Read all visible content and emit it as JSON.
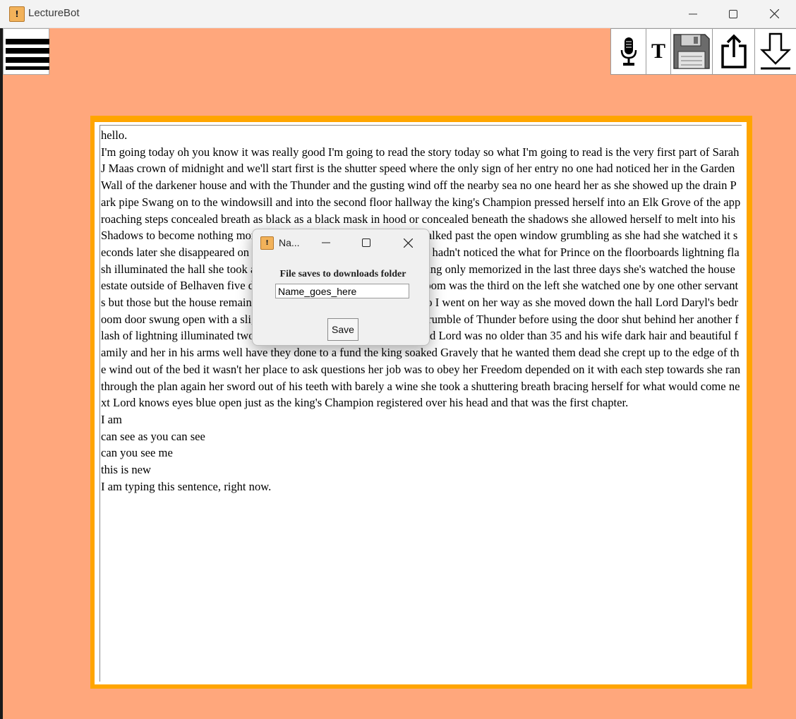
{
  "window": {
    "title": "LectureBot",
    "icon_glyph": "!"
  },
  "toolbar": {
    "menu_icon": "hamburger-menu-icon",
    "buttons": [
      {
        "name": "microphone-icon"
      },
      {
        "name": "text-icon",
        "glyph": "T"
      },
      {
        "name": "floppy-disk-save-icon"
      },
      {
        "name": "share-upload-icon"
      },
      {
        "name": "download-arrow-icon"
      }
    ]
  },
  "colors": {
    "background": "#ffa77c",
    "frame": "#ffa500"
  },
  "transcript": {
    "lines": [
      "hello.",
      "I'm going today oh you know it was really good I'm going to read the story today so what I'm going to read is the very first part of Sarah J Maas crown of midnight and we'll start first is the shutter speed where the only sign of her entry no one had noticed her in the Garden Wall of the darkener house and with the Thunder and the gusting wind off the nearby sea no one heard her as she showed up the drain Park pipe Swang on to the windowsill and into the second floor hallway the king's Champion pressed herself into an Elk Grove of the approaching steps concealed breath as black as a black mask in hood or concealed beneath the shadows she allowed herself to melt into his Shadows to become nothing more than a slip of Darkness a servant walked past the open window grumbling as she had she watched it seconds later she disappeared on the stairs at the end of the hall the girl hadn't noticed the what for Prince on the floorboards lightning flash illuminated the hall she took a long breath going over the plans taking only memorized in the last three days she's watched the house estate outside of Belhaven five doors on each side Lorde Royals bedroom was the third on the left she watched one by one other servants but those but the house remained as the storm Bridge around them so I went on her way as she moved down the hall Lord Daryl's bedroom door swung open with a slight grown she waited until the next Grumble of Thunder before using the door shut behind her another flash of lightning illuminated two figures sleeping in the four-poster bed Lord was no older than 35 and his wife dark hair and beautiful family and her in his arms well have they done to a fund the king soaked Gravely that he wanted them dead she crept up to the edge of the wind out of the bed it wasn't her place to ask questions her job was to obey her Freedom depended on it with each step towards she ran through the plan again her sword out of his teeth with barely a wine she took a shuttering breath bracing herself for what would come next Lord knows eyes blue open just as the king's Champion registered over his head and that was the first chapter.",
      "I am",
      "can see as you can see",
      "can you see me",
      "this is new",
      "I am typing this sentence, right now."
    ]
  },
  "dialog": {
    "title": "Na...",
    "label": "File saves to downloads folder",
    "input_value": "Name_goes_here",
    "save_label": "Save"
  }
}
